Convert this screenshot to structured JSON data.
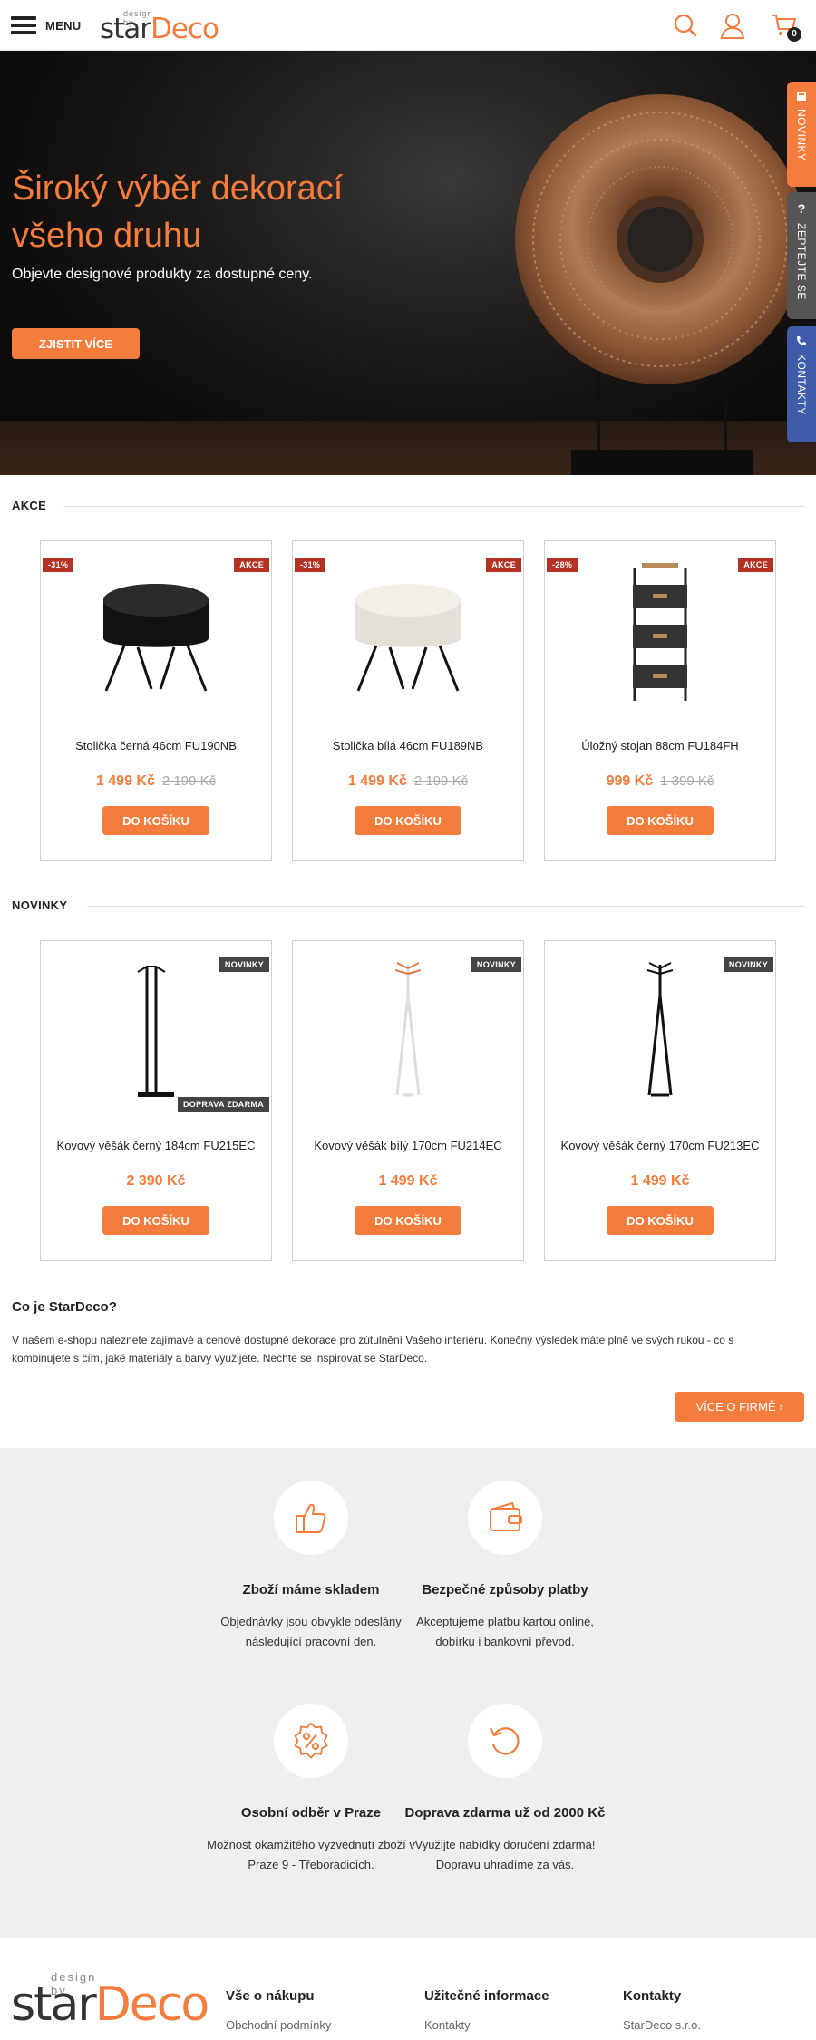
{
  "header": {
    "menu_label": "MENU",
    "logo_small": "design by",
    "logo_star": "star",
    "logo_deco": "Deco",
    "cart_count": "0"
  },
  "hero": {
    "title": "Široký výběr dekorací všeho druhu",
    "subtitle": "Objevte designové produkty za dostupné ceny.",
    "cta": "ZJISTIT VÍCE"
  },
  "side_tabs": {
    "novinky": "NOVINKY",
    "ask": "ZEPTEJTE SE",
    "contacts": "KONTAKTY"
  },
  "akce": {
    "title": "AKCE",
    "products": [
      {
        "discount": "-31%",
        "badge": "AKCE",
        "name": "Stolička černá 46cm FU190NB",
        "price": "1 499 Kč",
        "old_price": "2 199 Kč",
        "button": "DO KOŠÍKU"
      },
      {
        "discount": "-31%",
        "badge": "AKCE",
        "name": "Stolička bílá 46cm FU189NB",
        "price": "1 499 Kč",
        "old_price": "2 199 Kč",
        "button": "DO KOŠÍKU"
      },
      {
        "discount": "-28%",
        "badge": "AKCE",
        "name": "Úložný stojan 88cm FU184FH",
        "price": "999 Kč",
        "old_price": "1 399 Kč",
        "button": "DO KOŠÍKU"
      }
    ]
  },
  "novinky": {
    "title": "NOVINKY",
    "products": [
      {
        "badge": "NOVINKY",
        "badge2": "DOPRAVA ZDARMA",
        "name": "Kovový věšák černý 184cm FU215EC",
        "price": "2 390 Kč",
        "button": "DO KOŠÍKU"
      },
      {
        "badge": "NOVINKY",
        "name": "Kovový věšák bílý 170cm FU214EC",
        "price": "1 499 Kč",
        "button": "DO KOŠÍKU"
      },
      {
        "badge": "NOVINKY",
        "name": "Kovový věšák černý 170cm FU213EC",
        "price": "1 499 Kč",
        "button": "DO KOŠÍKU"
      }
    ]
  },
  "about": {
    "title": "Co je StarDeco?",
    "text": "V našem e-shopu naleznete zajímavé a cenově dostupné dekorace pro zútulnění Vašeho interiéru. Konečný výsledek máte plně ve svých rukou - co s kombinujete s čím, jaké materiály a barvy využijete. Nechte se inspirovat se StarDeco.",
    "button": "VÍCE O FIRMĚ"
  },
  "features": [
    {
      "icon": "thumbs-up-icon",
      "title": "Zboží máme skladem",
      "text": "Objednávky jsou obvykle odeslány následující pracovní den."
    },
    {
      "icon": "wallet-icon",
      "title": "Bezpečné způsoby platby",
      "text": "Akceptujeme platbu kartou online, dobírku i bankovní převod."
    },
    {
      "icon": "percent-badge-icon",
      "title": "Osobní odběr v Praze",
      "text": "Možnost okamžitého vyzvednutí zboží v Praze 9 - Třeboradicích."
    },
    {
      "icon": "refresh-icon",
      "title": "Doprava zdarma už od 2000 Kč",
      "text": "Využijte nabídky doručení zdarma! Dopravu uhradíme za vás."
    }
  ],
  "footer": {
    "logo_small": "design by",
    "logo_star": "star",
    "logo_deco": "Deco",
    "col1_title": "Vše o nákupu",
    "col1_link": "Obchodní podmínky",
    "col2_title": "Užitečné informace",
    "col2_link": "Kontakty",
    "col3_title": "Kontakty",
    "col3_link": "StarDeco s.r.o."
  },
  "colors": {
    "accent": "#f47c3c",
    "badge_red": "#b33224",
    "badge_dark": "#444444",
    "tab_blue": "#3f5ba9"
  }
}
